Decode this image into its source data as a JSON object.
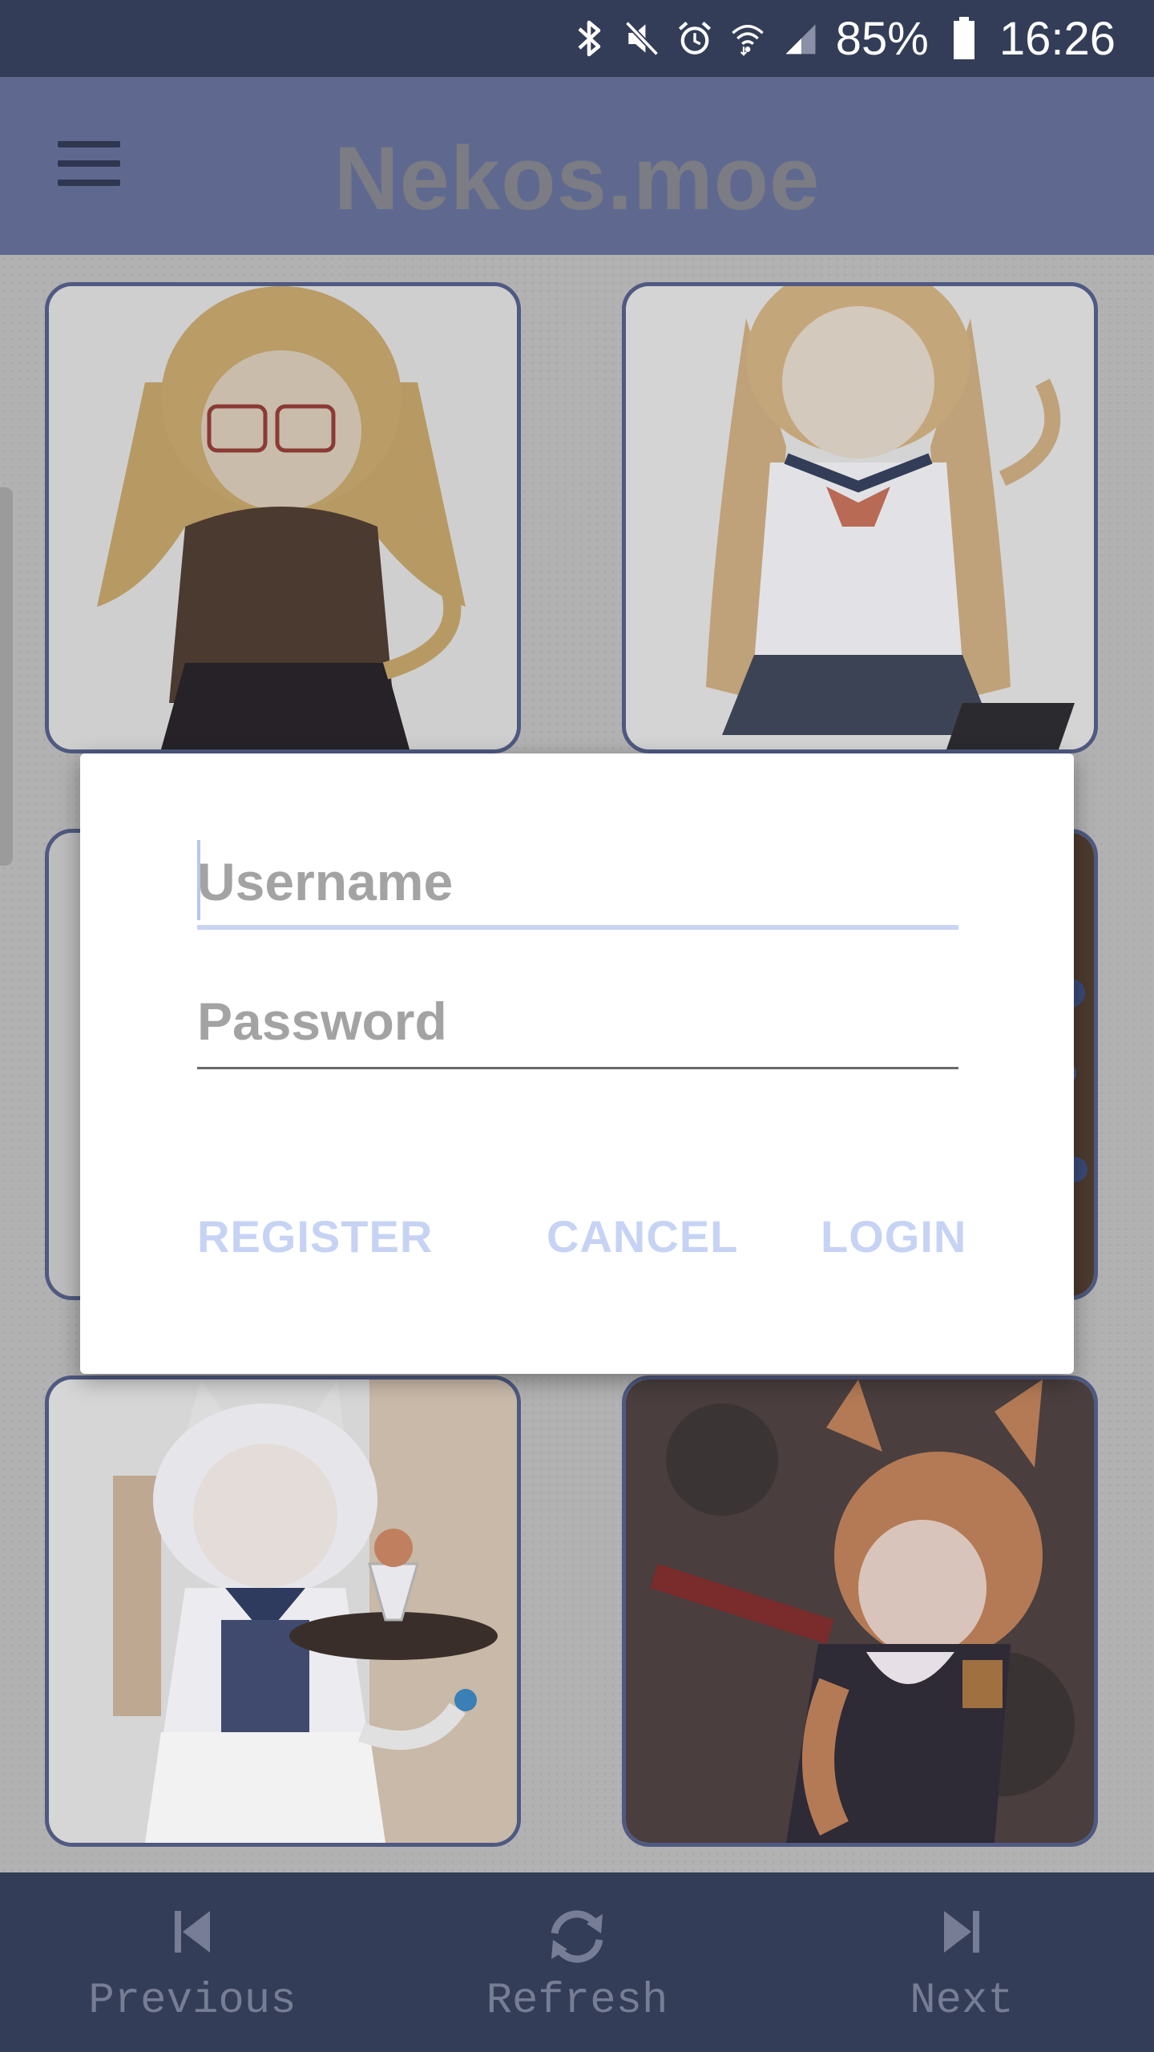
{
  "status_bar": {
    "battery_percent": "85%",
    "time": "16:26",
    "icons": [
      "bluetooth-icon",
      "mute-icon",
      "alarm-icon",
      "wifi-icon",
      "signal-icon",
      "battery-icon"
    ]
  },
  "app_bar": {
    "title": "Nekos.moe",
    "menu_icon": "hamburger-menu-icon"
  },
  "gallery": {
    "images": [
      {
        "description": "blonde neko girl with glasses in brown hoodie"
      },
      {
        "description": "blonde neko girl in sailor uniform"
      },
      {
        "description": "partially hidden image"
      },
      {
        "description": "partially hidden image"
      },
      {
        "description": "white haired neko maid holding parfait"
      },
      {
        "description": "orange haired neko girl in military uniform"
      }
    ]
  },
  "login_dialog": {
    "username_placeholder": "Username",
    "password_placeholder": "Password",
    "register_label": "REGISTER",
    "cancel_label": "CANCEL",
    "login_label": "LOGIN"
  },
  "bottom_nav": {
    "previous_label": "Previous",
    "refresh_label": "Refresh",
    "next_label": "Next"
  },
  "colors": {
    "status_bar": "#333d57",
    "app_bar": "#5f6990",
    "accent": "#c6d3f4",
    "card_border": "#4f5a82"
  }
}
